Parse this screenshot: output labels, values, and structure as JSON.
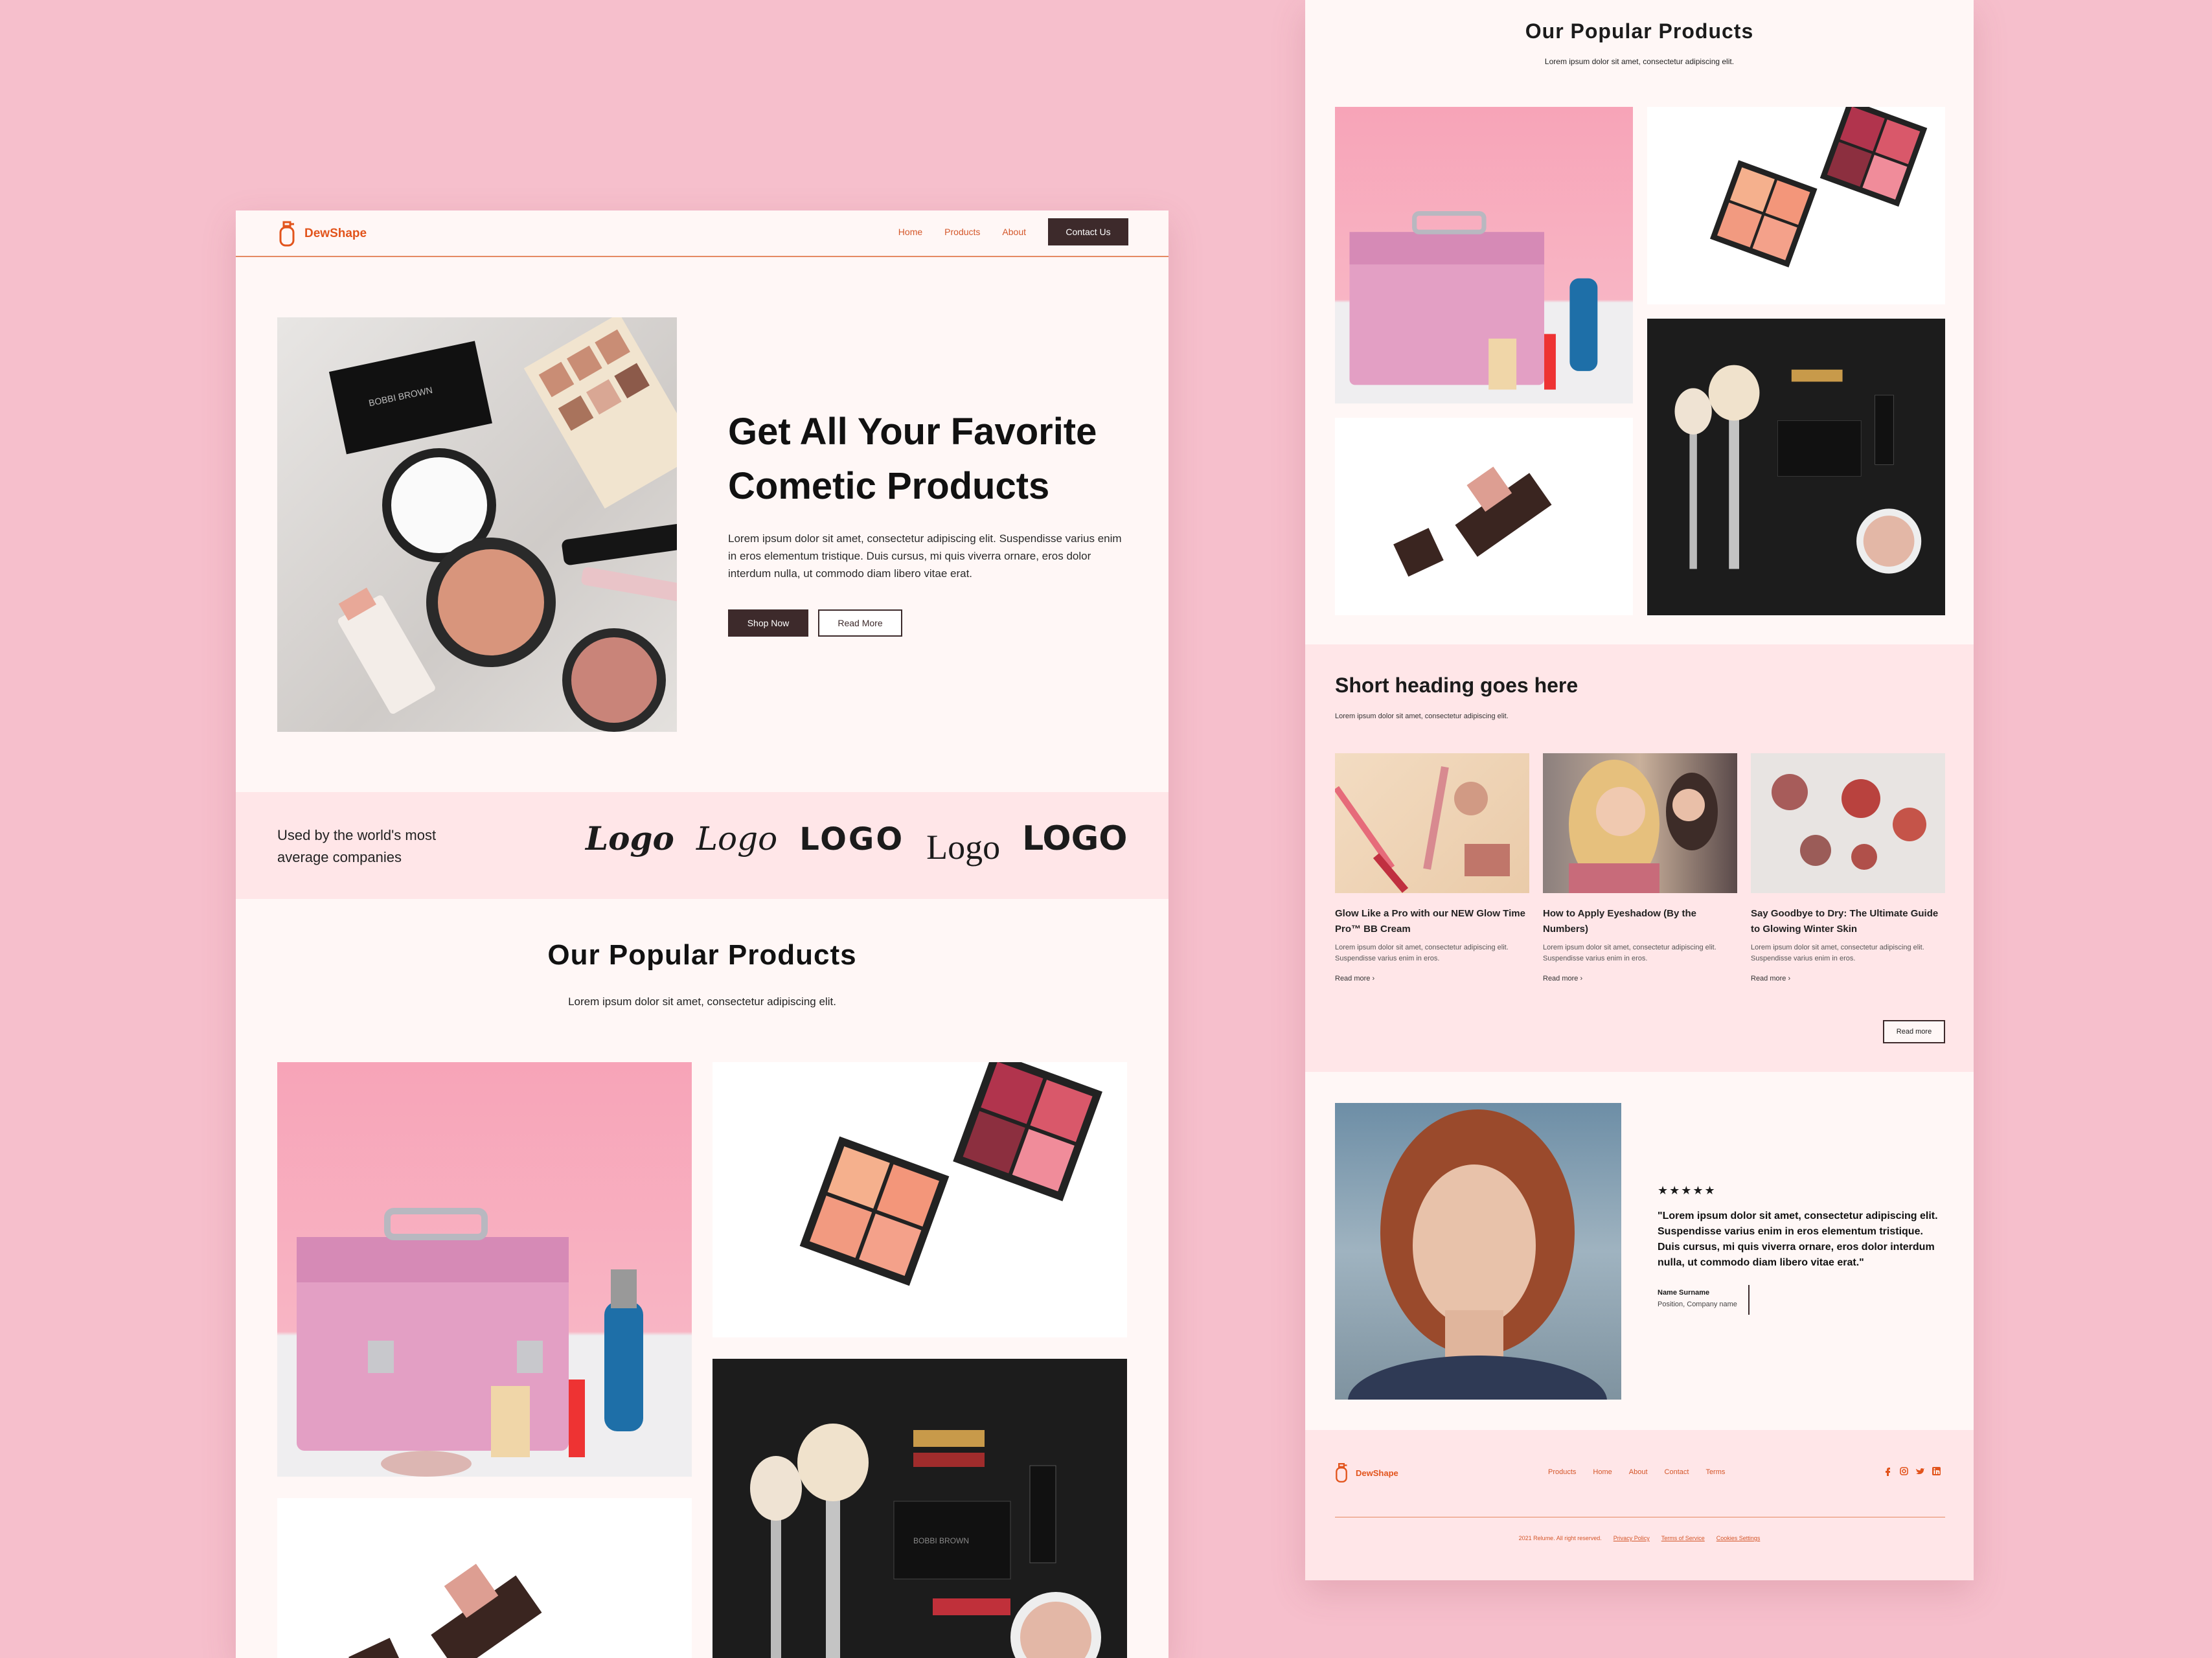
{
  "brand": {
    "name": "DewShape",
    "accent": "#e2541c",
    "dark": "#3d2a2b",
    "background": "#f6bfcc"
  },
  "nav": {
    "links": [
      "Home",
      "Products",
      "About"
    ],
    "contact_label": "Contact Us"
  },
  "hero": {
    "title_line1": "Get All Your Favorite",
    "title_line2": "Cometic Products",
    "body": "Lorem ipsum dolor sit amet, consectetur adipiscing elit. Suspendisse varius enim in eros elementum tristique. Duis cursus, mi quis viverra ornare, eros dolor interdum nulla, ut commodo diam libero vitae erat.",
    "primary_button": "Shop Now",
    "secondary_button": "Read More"
  },
  "logos": {
    "tagline_line1": "Used by the world's most",
    "tagline_line2": "average companies",
    "items": [
      "Logo",
      "Logo",
      "LOGO",
      "Logo",
      "LOGO"
    ]
  },
  "popular": {
    "title": "Our Popular Products",
    "subtitle": "Lorem ipsum dolor sit amet, consectetur adipiscing elit."
  },
  "blog": {
    "heading": "Short heading goes here",
    "subtitle": "Lorem ipsum dolor sit amet, consectetur adipiscing elit.",
    "cards": [
      {
        "title": "Glow Like a Pro with our NEW Glow Time Pro™ BB Cream",
        "text": "Lorem ipsum dolor sit amet, consectetur adipiscing elit. Suspendisse varius enim in eros.",
        "link": "Read more"
      },
      {
        "title": "How to Apply Eyeshadow (By the Numbers)",
        "text": "Lorem ipsum dolor sit amet, consectetur adipiscing elit. Suspendisse varius enim in eros.",
        "link": "Read more"
      },
      {
        "title": "Say Goodbye to Dry: The Ultimate Guide to Glowing Winter Skin",
        "text": "Lorem ipsum dolor sit amet, consectetur adipiscing elit. Suspendisse varius enim in eros.",
        "link": "Read more"
      }
    ],
    "read_more_button": "Read more"
  },
  "testimonial": {
    "stars": "★★★★★",
    "quote": "\"Lorem ipsum dolor sit amet, consectetur adipiscing elit. Suspendisse varius enim in eros elementum tristique. Duis cursus, mi quis viverra ornare, eros dolor interdum nulla, ut commodo diam libero vitae erat.\"",
    "name": "Name Surname",
    "position": "Position, Company name"
  },
  "footer": {
    "brand": "DewShape",
    "links": [
      "Products",
      "Home",
      "About",
      "Contact",
      "Terms"
    ],
    "social_icons": [
      "facebook-icon",
      "instagram-icon",
      "twitter-icon",
      "linkedin-icon"
    ],
    "copyright": "2021 Relume. All right reserved.",
    "legal": [
      "Privacy Policy",
      "Terms of Service",
      "Cookies Settings"
    ]
  }
}
